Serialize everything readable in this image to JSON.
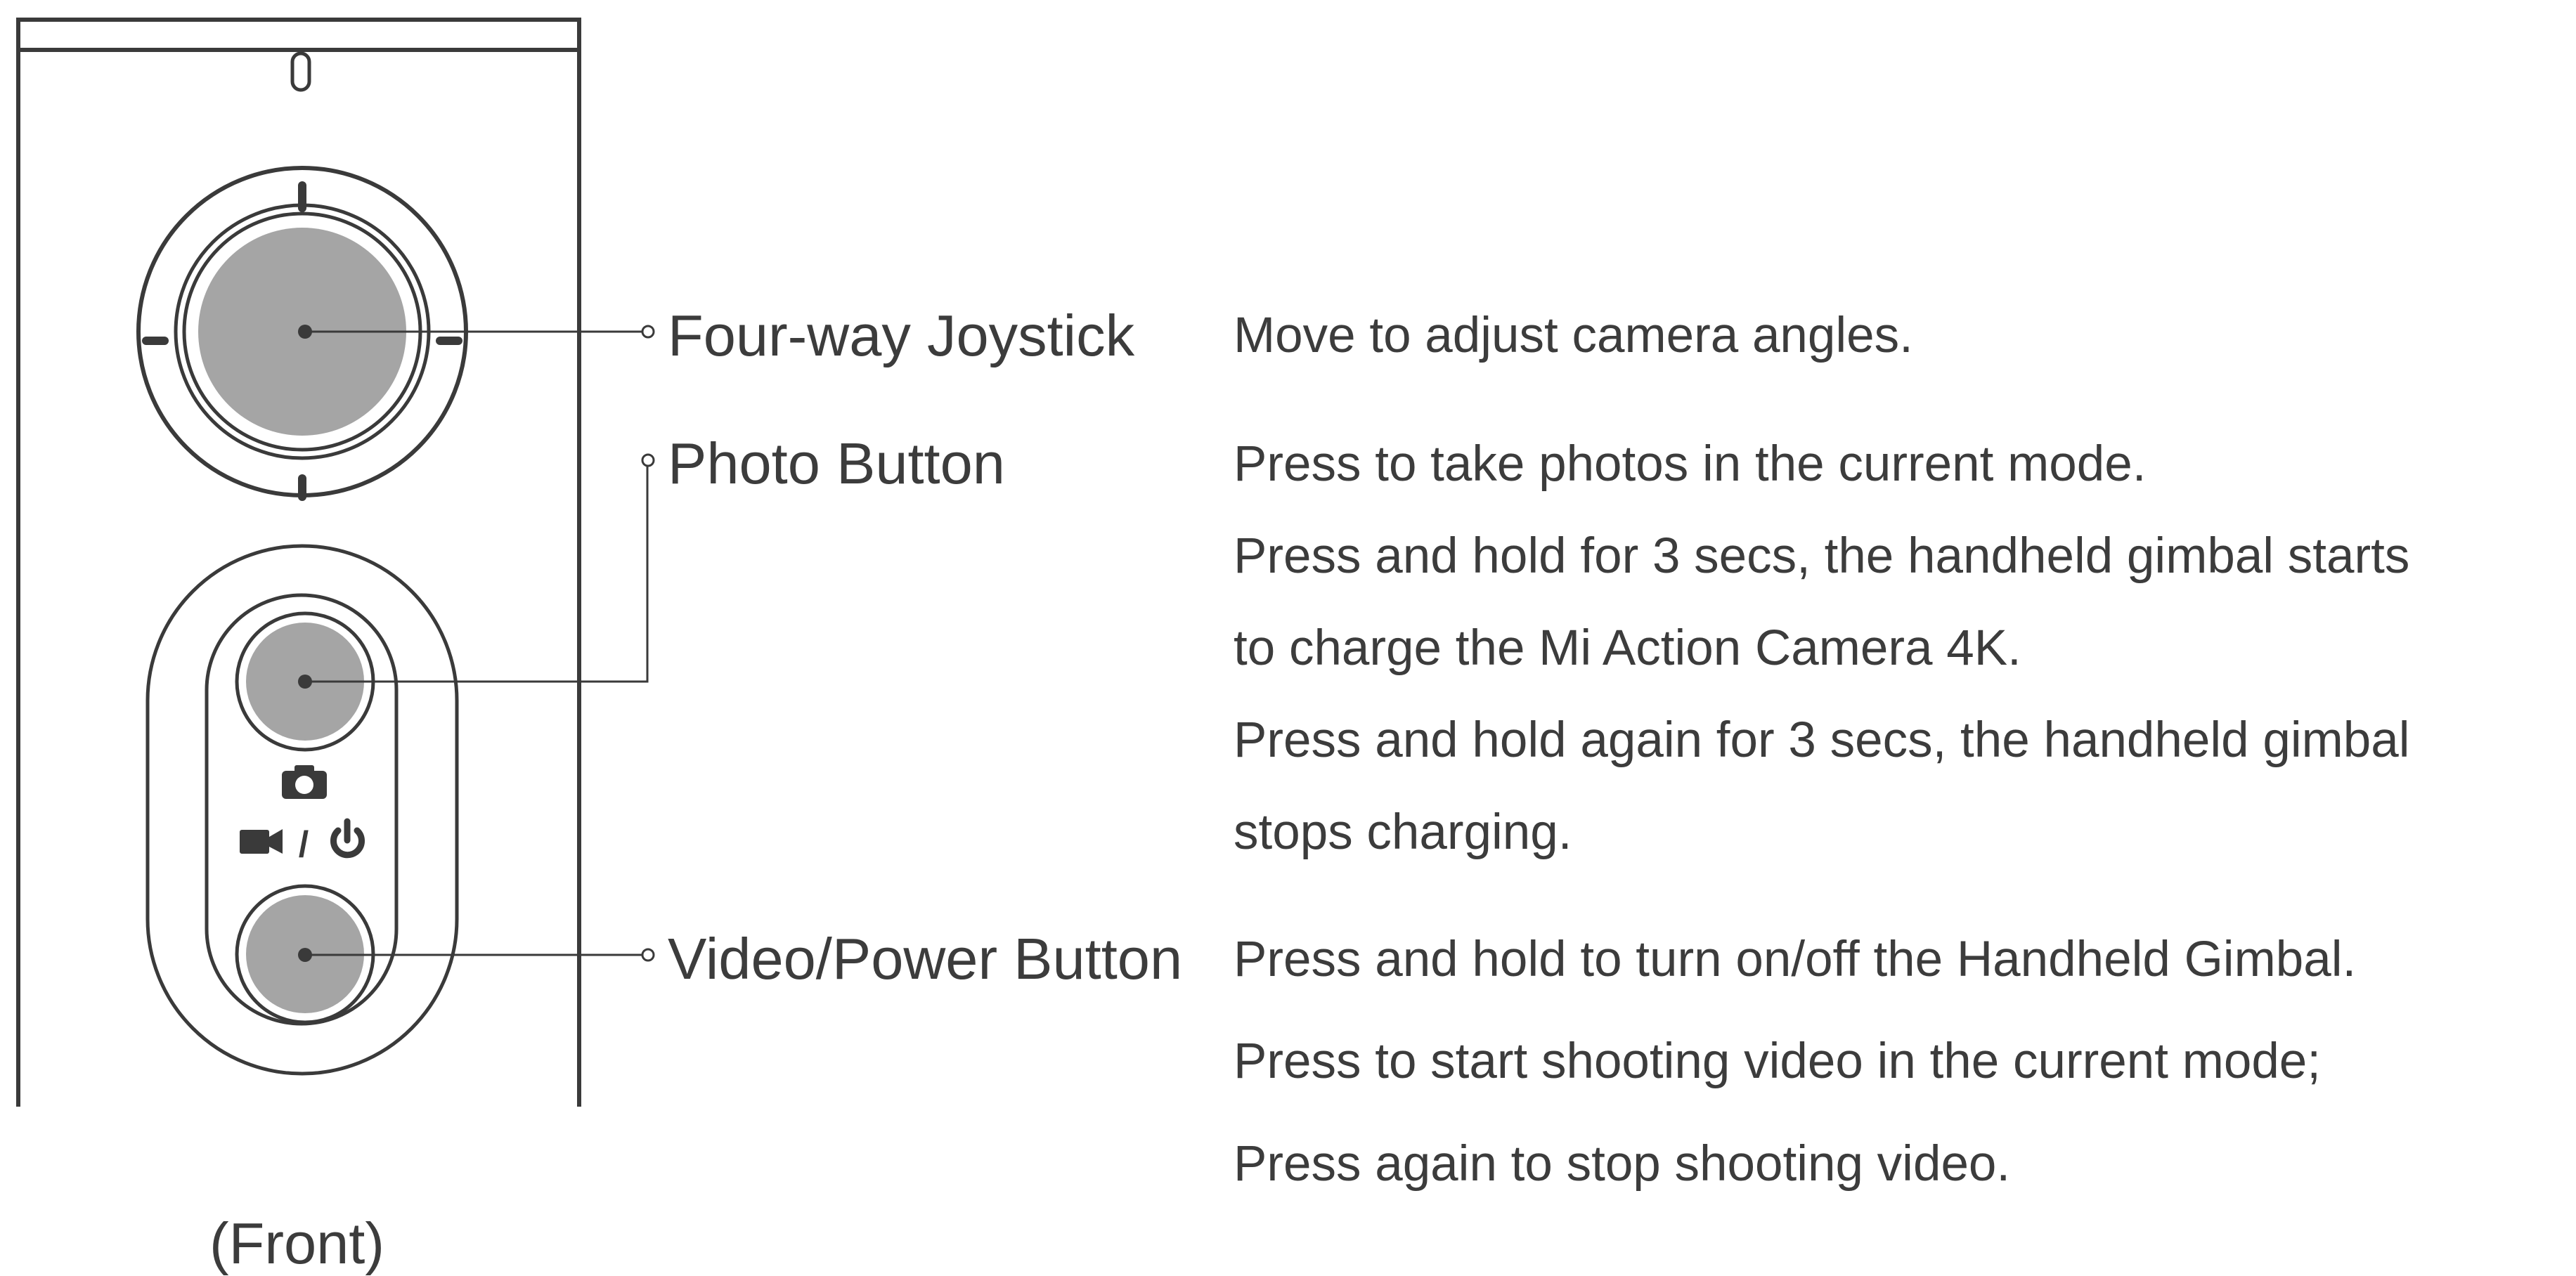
{
  "caption": "(Front)",
  "icons": {
    "photo": "camera-icon",
    "video": "video-camera-icon",
    "separator": "/",
    "power": "power-icon"
  },
  "colors": {
    "outline": "#3a3a3a",
    "button_fill": "#a5a5a5",
    "text": "#3c3c3c"
  },
  "components": [
    {
      "label": "Four-way Joystick",
      "description": [
        "Move to adjust camera angles."
      ]
    },
    {
      "label": "Photo Button",
      "description": [
        "Press to take photos in the current mode.",
        "Press and hold for 3 secs, the handheld gimbal starts",
        "to charge the Mi Action Camera 4K.",
        "Press and hold again for 3 secs, the handheld gimbal",
        "stops charging."
      ]
    },
    {
      "label": "Video/Power Button",
      "description": [
        "Press and hold to turn on/off the Handheld Gimbal.",
        "Press to start shooting video in the current mode;",
        "Press again to stop shooting video."
      ]
    }
  ]
}
